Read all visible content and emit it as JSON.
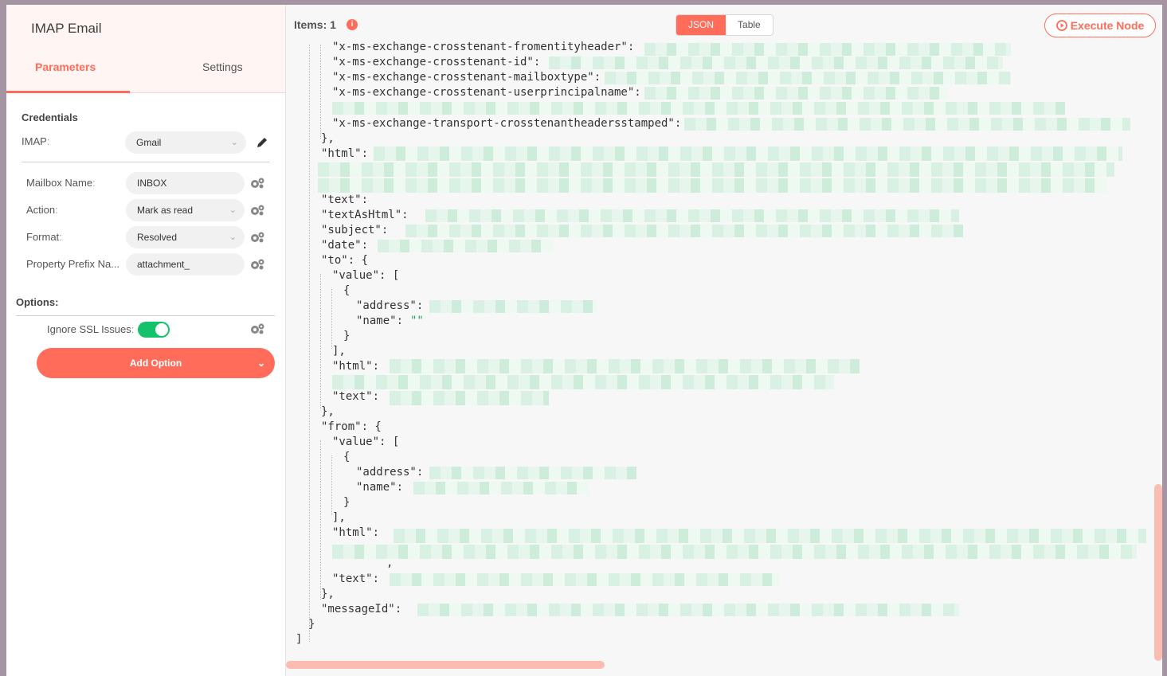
{
  "node": {
    "title": "IMAP Email",
    "tabs": {
      "parameters": "Parameters",
      "settings": "Settings"
    }
  },
  "credentials": {
    "section_title": "Credentials",
    "imap_label": "IMAP",
    "imap_value": "Gmail"
  },
  "params": {
    "mailbox_label": "Mailbox Name",
    "mailbox_value": "INBOX",
    "action_label": "Action",
    "action_value": "Mark as read",
    "format_label": "Format",
    "format_value": "Resolved",
    "prefix_label": "Property Prefix Na...",
    "prefix_value": "attachment_"
  },
  "options": {
    "section_title": "Options:",
    "ssl_label": "Ignore SSL Issues",
    "ssl_enabled": true,
    "add_option_label": "Add Option"
  },
  "output": {
    "items_label": "Items: 1",
    "view_json": "JSON",
    "view_table": "Table",
    "execute_label": "Execute Node",
    "lines": [
      "\"x-ms-exchange-crosstenant-fromentityheader\":",
      "\"x-ms-exchange-crosstenant-id\":",
      "\"x-ms-exchange-crosstenant-mailboxtype\":",
      "\"x-ms-exchange-crosstenant-userprincipalname\":",
      "\"x-ms-exchange-transport-crosstenantheadersstamped\":",
      "},",
      "\"html\":",
      "\"text\":",
      "\"textAsHtml\":",
      "\"subject\":",
      "\"date\":",
      "\"to\": {",
      "\"value\": [",
      "{",
      "\"address\":",
      "\"name\":",
      "\"\"",
      "}",
      "],",
      "\"html\":",
      "\"text\":",
      "},",
      "\"from\": {",
      "\"value\": [",
      "{",
      "\"address\":",
      "\"name\":",
      "}",
      "],",
      "\"html\":",
      ",",
      "\"text\":",
      "},",
      "\"messageId\":",
      "}",
      "]"
    ]
  },
  "colors": {
    "accent": "#ff6d5a",
    "toggle_on": "#13c26a",
    "string_green": "#2aa36a"
  }
}
